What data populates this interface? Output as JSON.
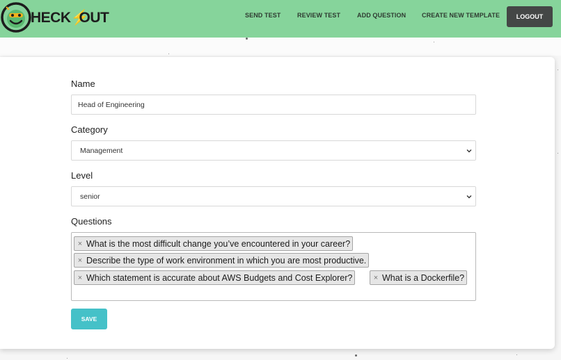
{
  "brand": {
    "logo_prefix": "HECK",
    "logo_bolt": "⚡",
    "logo_suffix": "OUT",
    "header_color": "#86d49b",
    "accent": "#f2b01e"
  },
  "nav": {
    "items": [
      {
        "label": "SEND TEST"
      },
      {
        "label": "REVIEW TEST"
      },
      {
        "label": "ADD QUESTION"
      },
      {
        "label": "CREATE NEW TEMPLATE"
      }
    ],
    "logout_label": "LOGOUT"
  },
  "form": {
    "name_label": "Name",
    "name_value": "Head of Engineering",
    "category_label": "Category",
    "category_value": "Management",
    "level_label": "Level",
    "level_value": "senior",
    "questions_label": "Questions",
    "questions": [
      "What is the most difficult change you’ve encountered in your career?",
      "Describe the type of work environment in which you are most productive.",
      "Which statement is accurate about AWS Budgets and Cost Explorer?",
      "What is a Dockerfile?"
    ],
    "remove_symbol": "×",
    "save_label": "SAVE",
    "save_color": "#45c1c8"
  }
}
